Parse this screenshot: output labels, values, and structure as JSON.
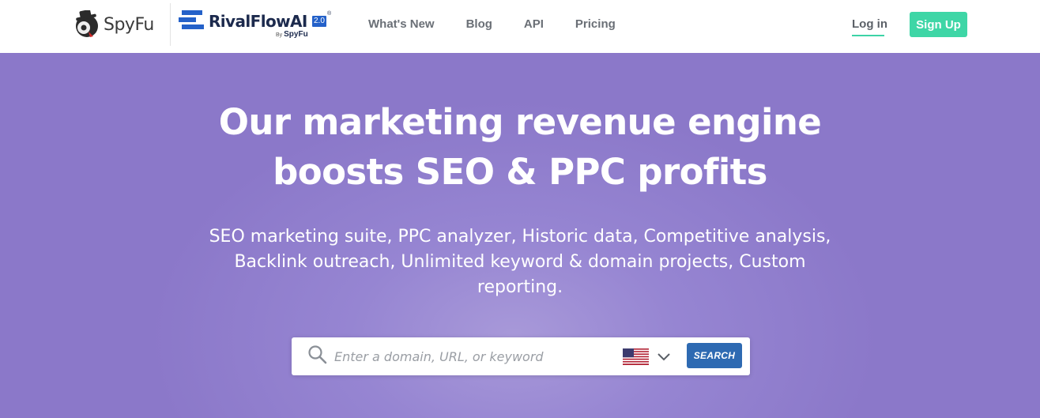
{
  "header": {
    "spyfu_logo_text": "SpyFu",
    "rival_logo_text": "RivalFlowAI",
    "rival_version": "2.0",
    "rival_reg": "®",
    "rival_by_prefix": "By",
    "rival_by_brand": "SpyFu",
    "nav": {
      "whats_new": "What's New",
      "blog": "Blog",
      "api": "API",
      "pricing": "Pricing"
    },
    "login_label": "Log in",
    "signup_label": "Sign Up"
  },
  "hero": {
    "headline_line1": "Our marketing revenue engine",
    "headline_line2": "boosts SEO & PPC profits",
    "subtext": "SEO marketing suite, PPC analyzer, Historic data, Competitive analysis, Backlink outreach, Unlimited keyword & domain projects, Custom reporting."
  },
  "search": {
    "placeholder": "Enter a domain, URL, or keyword",
    "value": "",
    "country_flag": "us-flag-icon",
    "button_label": "SEARCH"
  },
  "colors": {
    "accent_green": "#3ed6a6",
    "hero_purple": "#8b78c9",
    "search_button_blue": "#2e6ab2",
    "rival_blue": "#2461c9"
  }
}
